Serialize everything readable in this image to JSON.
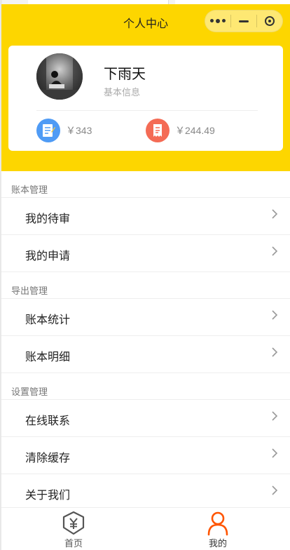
{
  "nav": {
    "title": "个人中心"
  },
  "profile": {
    "name": "下雨天",
    "subtitle": "基本信息"
  },
  "stats": [
    {
      "value": "￥343",
      "icon": "note-icon",
      "color": "#4f9bf5"
    },
    {
      "value": "￥244.49",
      "icon": "receipt-icon",
      "color": "#f46b55"
    }
  ],
  "sections": [
    {
      "title": "账本管理",
      "items": [
        "我的待审",
        "我的申请"
      ]
    },
    {
      "title": "导出管理",
      "items": [
        "账本统计",
        "账本明细"
      ]
    },
    {
      "title": "设置管理",
      "items": [
        "在线联系",
        "清除缓存",
        "关于我们"
      ]
    }
  ],
  "tabbar": {
    "items": [
      {
        "label": "首页",
        "icon": "yen-shield-icon",
        "active": false
      },
      {
        "label": "我的",
        "icon": "person-icon",
        "active": true
      }
    ]
  },
  "colors": {
    "accent": "#fdd600",
    "tab_active": "#ff5500",
    "tab_inactive": "#555555"
  }
}
